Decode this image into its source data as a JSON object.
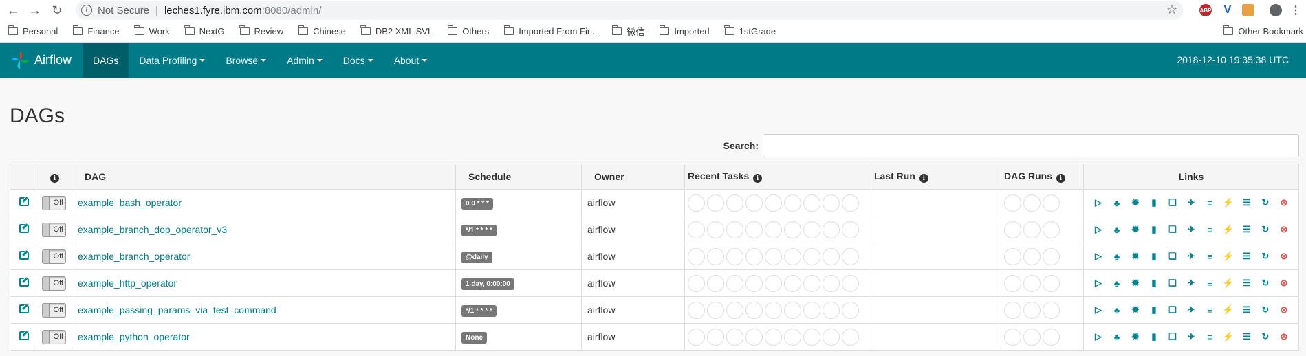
{
  "browser": {
    "security": "Not Secure",
    "host": "leches1.fyre.ibm.com",
    "path": ":8080/admin/",
    "bookmarks": [
      "Personal",
      "Finance",
      "Work",
      "NextG",
      "Review",
      "Chinese",
      "DB2 XML SVL",
      "Others",
      "Imported From Fir...",
      "微信",
      "Imported",
      "1stGrade"
    ],
    "other_bookmarks": "Other Bookmark",
    "ext_abp": "ABP"
  },
  "navbar": {
    "brand": "Airflow",
    "items": [
      {
        "label": "DAGs",
        "dropdown": false
      },
      {
        "label": "Data Profiling",
        "dropdown": true
      },
      {
        "label": "Browse",
        "dropdown": true
      },
      {
        "label": "Admin",
        "dropdown": true
      },
      {
        "label": "Docs",
        "dropdown": true
      },
      {
        "label": "About",
        "dropdown": true
      }
    ],
    "clock": "2018-12-10 19:35:38 UTC"
  },
  "page": {
    "title": "DAGs",
    "search_label": "Search:",
    "search_value": ""
  },
  "table": {
    "headers": {
      "info": "i",
      "dag": "DAG",
      "schedule": "Schedule",
      "owner": "Owner",
      "recent_tasks": "Recent Tasks",
      "last_run": "Last Run",
      "dag_runs": "DAG Runs",
      "links": "Links"
    },
    "toggle_label": "Off",
    "rows": [
      {
        "dag": "example_bash_operator",
        "schedule": "0 0 * * *",
        "owner": "airflow"
      },
      {
        "dag": "example_branch_dop_operator_v3",
        "schedule": "*/1 * * * *",
        "owner": "airflow"
      },
      {
        "dag": "example_branch_operator",
        "schedule": "@daily",
        "owner": "airflow"
      },
      {
        "dag": "example_http_operator",
        "schedule": "1 day, 0:00:00",
        "owner": "airflow"
      },
      {
        "dag": "example_passing_params_via_test_command",
        "schedule": "*/1 * * * *",
        "owner": "airflow"
      },
      {
        "dag": "example_python_operator",
        "schedule": "None",
        "owner": "airflow"
      }
    ],
    "recent_task_circles": 9,
    "dag_run_circles": 3,
    "link_icons": [
      "trigger-dag-icon",
      "tree-view-icon",
      "graph-view-icon",
      "task-duration-icon",
      "task-tries-icon",
      "landing-times-icon",
      "gantt-icon",
      "code-view-icon",
      "logs-icon",
      "refresh-icon",
      "delete-icon"
    ]
  },
  "colors": {
    "navbar": "#007a87",
    "accent": "#00838f",
    "delete": "#d9534f"
  }
}
